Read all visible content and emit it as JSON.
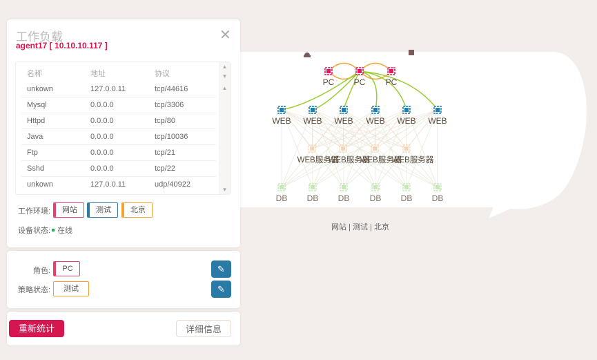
{
  "panel": {
    "title": "工作负载",
    "subtitle": "agent17 [ 10.10.10.117 ]",
    "table": {
      "headers": [
        "名称",
        "地址",
        "协议"
      ],
      "rows": [
        [
          "unkown",
          "127.0.0.11",
          "tcp/44616"
        ],
        [
          "Mysql",
          "0.0.0.0",
          "tcp/3306"
        ],
        [
          "Httpd",
          "0.0.0.0",
          "tcp/80"
        ],
        [
          "Java",
          "0.0.0.0",
          "tcp/10036"
        ],
        [
          "Ftp",
          "0.0.0.0",
          "tcp/21"
        ],
        [
          "Sshd",
          "0.0.0.0",
          "tcp/22"
        ],
        [
          "unkown",
          "127.0.0.11",
          "udp/40922"
        ]
      ]
    },
    "env_label": "工作环境:",
    "env_tags": [
      "网站",
      "测试",
      "北京"
    ],
    "status_label": "设备状态:",
    "status_value": "在线"
  },
  "role": {
    "role_label": "角色:",
    "role_value": "PC",
    "policy_label": "策略状态:",
    "policy_value": "测试"
  },
  "actions": {
    "recount": "重新统计",
    "details": "详细信息"
  },
  "graph": {
    "pc_label": "PC",
    "web_label": "WEB",
    "server_label": "WEB服务器",
    "db_label": "DB",
    "caption": "网站 | 测试 | 北京"
  },
  "colors": {
    "accent": "#d6164f",
    "blue": "#2b7aa5",
    "orange": "#f5a030",
    "green": "#9acd32"
  }
}
